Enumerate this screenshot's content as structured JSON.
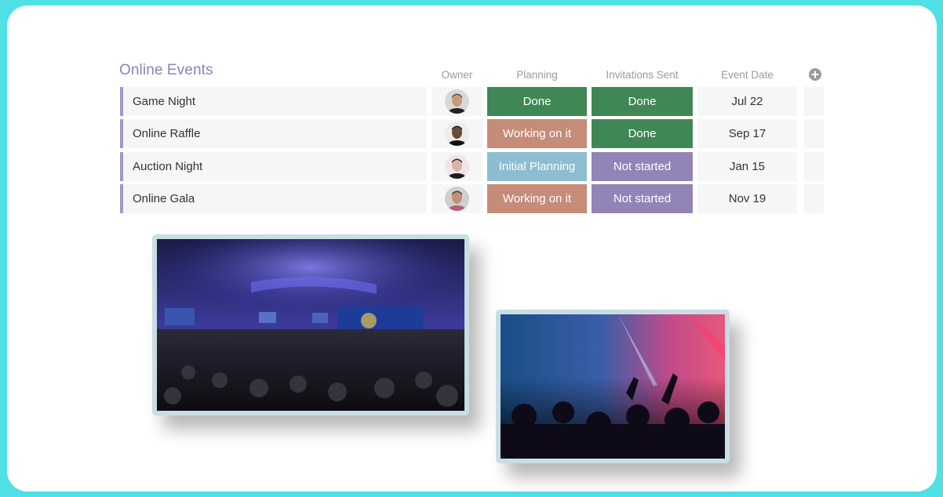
{
  "board": {
    "title": "Online Events",
    "columns": {
      "owner": "Owner",
      "planning": "Planning",
      "invitations": "Invitations Sent",
      "event_date": "Event Date"
    },
    "add_column_icon": "plus-circle-icon"
  },
  "status_colors": {
    "Done": "#3f8755",
    "Working on it": "#c48c79",
    "Initial Planning": "#8cbdd0",
    "Not started": "#9384b8"
  },
  "rows": [
    {
      "name": "Game Night",
      "owner": "man with short hair and beard",
      "planning": "Done",
      "invitations": "Done",
      "event_date": "Jul 22"
    },
    {
      "name": "Online Raffle",
      "owner": "smiling bald man",
      "planning": "Working on it",
      "invitations": "Done",
      "event_date": "Sep 17"
    },
    {
      "name": "Auction Night",
      "owner": "woman with dark hair",
      "planning": "Initial Planning",
      "invitations": "Not started",
      "event_date": "Jan 15"
    },
    {
      "name": "Online Gala",
      "owner": "man with beard and patterned shirt",
      "planning": "Working on it",
      "invitations": "Not started",
      "event_date": "Nov 19"
    }
  ],
  "images": [
    {
      "description": "Conference hall audience facing stage with blue lighting and screens"
    },
    {
      "description": "Concert crowd with raised hands under pink and blue stage lights"
    }
  ]
}
